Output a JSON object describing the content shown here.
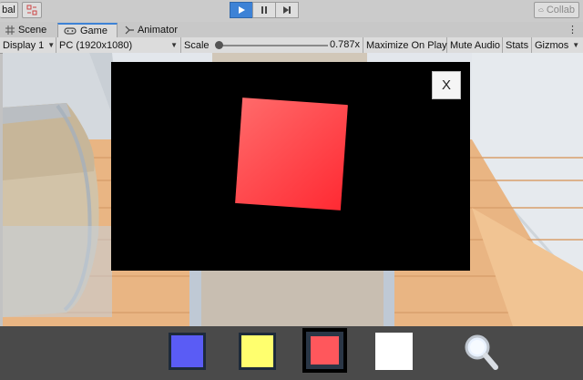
{
  "toolbar": {
    "left_label": "bal",
    "collab_label": "Collab",
    "collab_icon": "cloud-icon"
  },
  "tabs": [
    {
      "label": "Scene",
      "icon": "grid-icon"
    },
    {
      "label": "Game",
      "icon": "gamepad-icon"
    },
    {
      "label": "Animator",
      "icon": "animator-icon"
    }
  ],
  "game_bar": {
    "display": "Display 1",
    "resolution": "PC (1920x1080)",
    "scale_label": "Scale",
    "scale_value": "0.787x",
    "maximize": "Maximize On Play",
    "mute": "Mute Audio",
    "stats": "Stats",
    "gizmos": "Gizmos"
  },
  "popup": {
    "close_label": "X",
    "preview_color": "#ff3b42"
  },
  "palette": {
    "swatches": [
      {
        "name": "blue",
        "color": "#5a5cf5",
        "selected": false
      },
      {
        "name": "yellow",
        "color": "#ffff6e",
        "selected": false
      },
      {
        "name": "red",
        "color": "#ff575c",
        "selected": true
      },
      {
        "name": "white",
        "color": "#ffffff",
        "selected": false
      }
    ],
    "search_icon": "magnifier-icon"
  }
}
